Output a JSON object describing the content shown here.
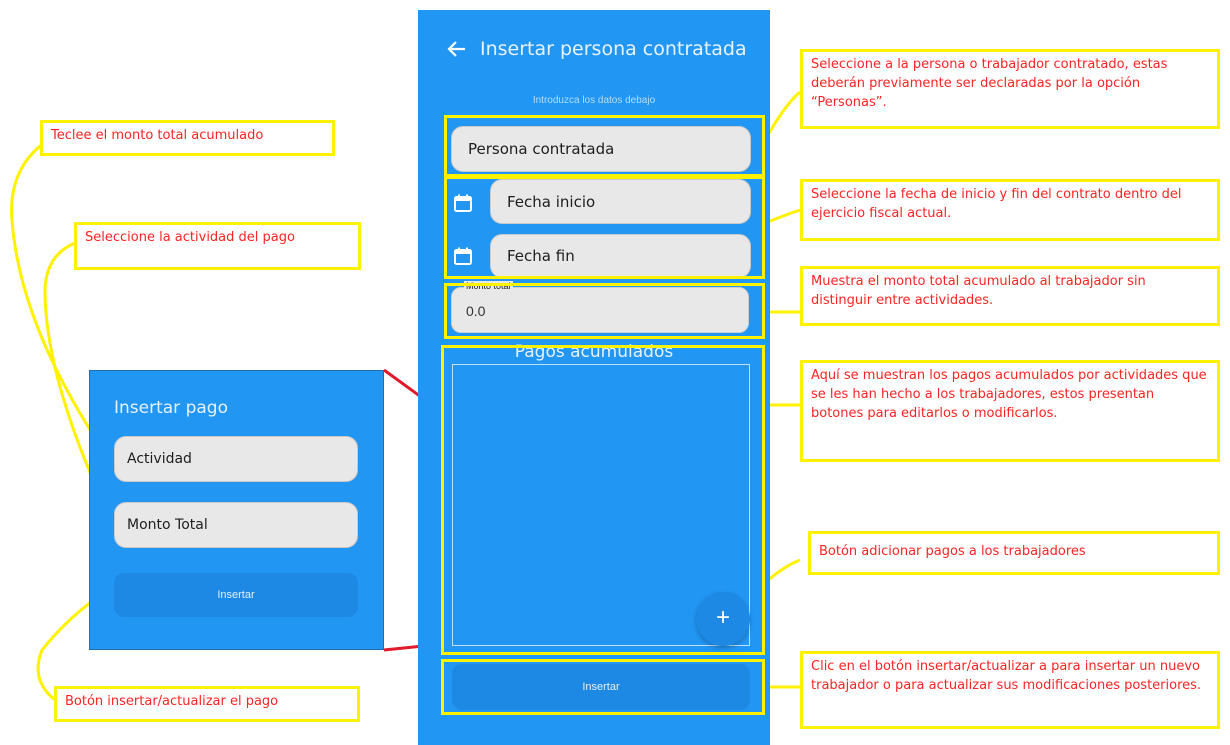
{
  "screen": {
    "title": "Insertar persona contratada",
    "hint": "Introduzca los datos debajo",
    "persona_placeholder": "Persona contratada",
    "fecha_inicio_placeholder": "Fecha inicio",
    "fecha_fin_placeholder": "Fecha fin",
    "monto_label": "Monto total",
    "monto_value": "0.0",
    "pagos_title": "Pagos acumulados",
    "fab_label": "+",
    "insert_label": "Insertar"
  },
  "dialog": {
    "title": "Insertar pago",
    "actividad_placeholder": "Actividad",
    "monto_placeholder": "Monto Total",
    "insert_label": "Insertar"
  },
  "annotations": {
    "persona": "Seleccione a la persona o trabajador contratado, estas deberán previamente ser declaradas por la opción “Personas”.",
    "fechas": "Seleccione la fecha de inicio y fin del contrato dentro del ejercicio fiscal actual.",
    "monto": "Muestra el monto total acumulado al trabajador sin distinguir entre actividades.",
    "pagos": "Aquí se muestran los pagos acumulados por actividades que se les han hecho a los trabajadores, estos presentan botones para editarlos o modificarlos.",
    "fab": "Botón adicionar pagos a los trabajadores",
    "insertar": "Clic en el botón insertar/actualizar a para insertar un nuevo trabajador o para actualizar sus modificaciones posteriores.",
    "dialog_monto": "Teclee el monto total acumulado",
    "dialog_actividad": "Seleccione la actividad del pago",
    "dialog_insertar": "Botón insertar/actualizar el pago"
  },
  "colors": {
    "screen_blue": "#2196f3",
    "button_blue": "#1e88e5",
    "highlight_yellow": "#fff200",
    "note_text_red": "#ff2323",
    "callout_red": "#e0192b"
  },
  "icons": {
    "back": "arrow-left-icon",
    "calendar": "calendar-icon",
    "add": "plus-icon"
  }
}
